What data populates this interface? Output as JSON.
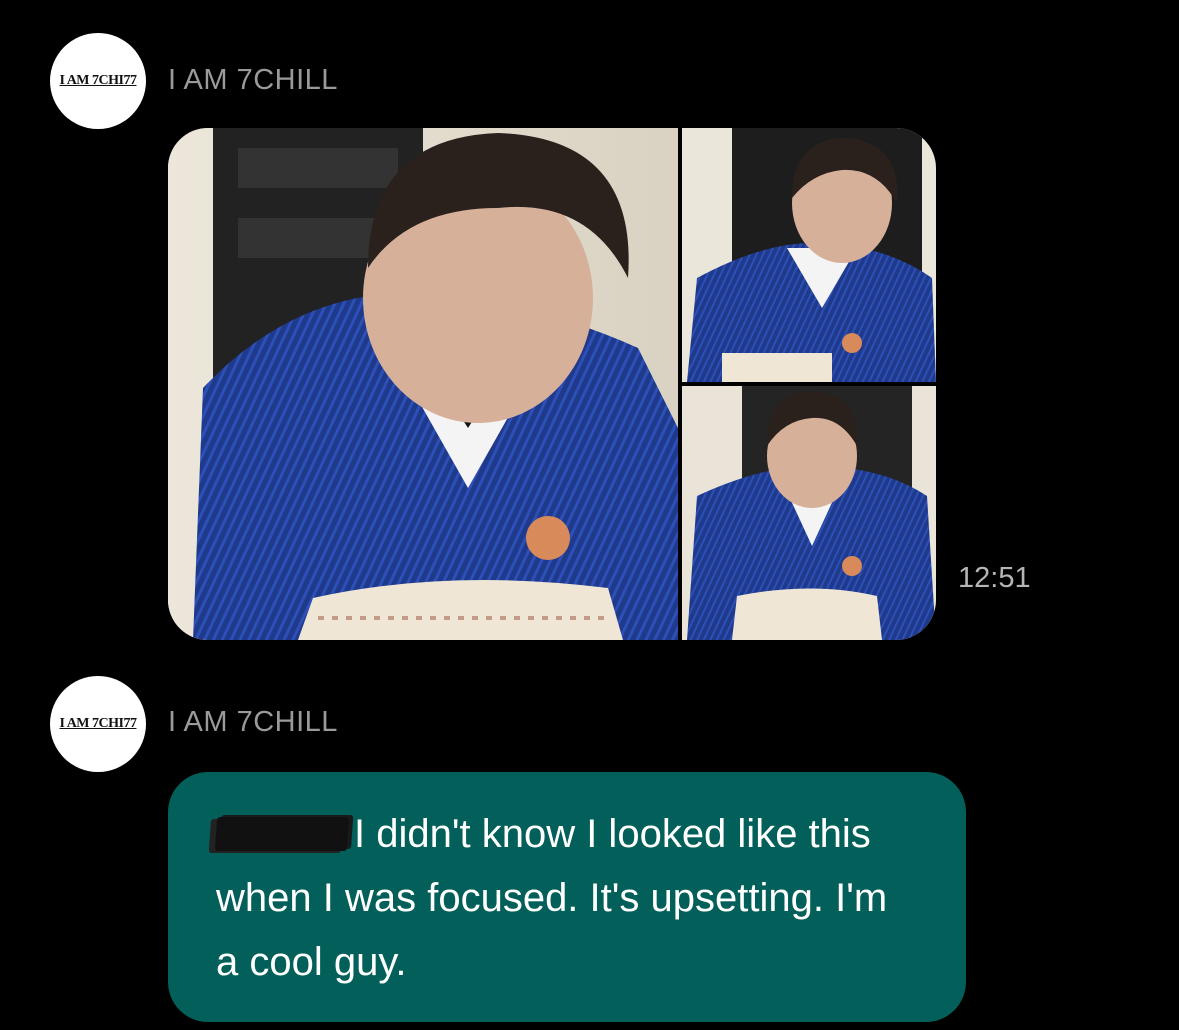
{
  "messages": [
    {
      "sender": "I AM 7CHILL",
      "avatar_text": "I AM 7CHI77",
      "type": "images",
      "image_count": 3,
      "time": "12:51"
    },
    {
      "sender": "I AM 7CHILL",
      "avatar_text": "I AM 7CHI77",
      "type": "text",
      "redacted_prefix": true,
      "text": "I didn't know I looked like this when I was focused. It's upsetting. I'm a cool guy.",
      "bubble_color": "#035f5a"
    }
  ],
  "colors": {
    "background": "#000000",
    "sender_name": "#9a9a9a",
    "timestamp": "#b5b5b5",
    "bubble": "#035f5a"
  }
}
